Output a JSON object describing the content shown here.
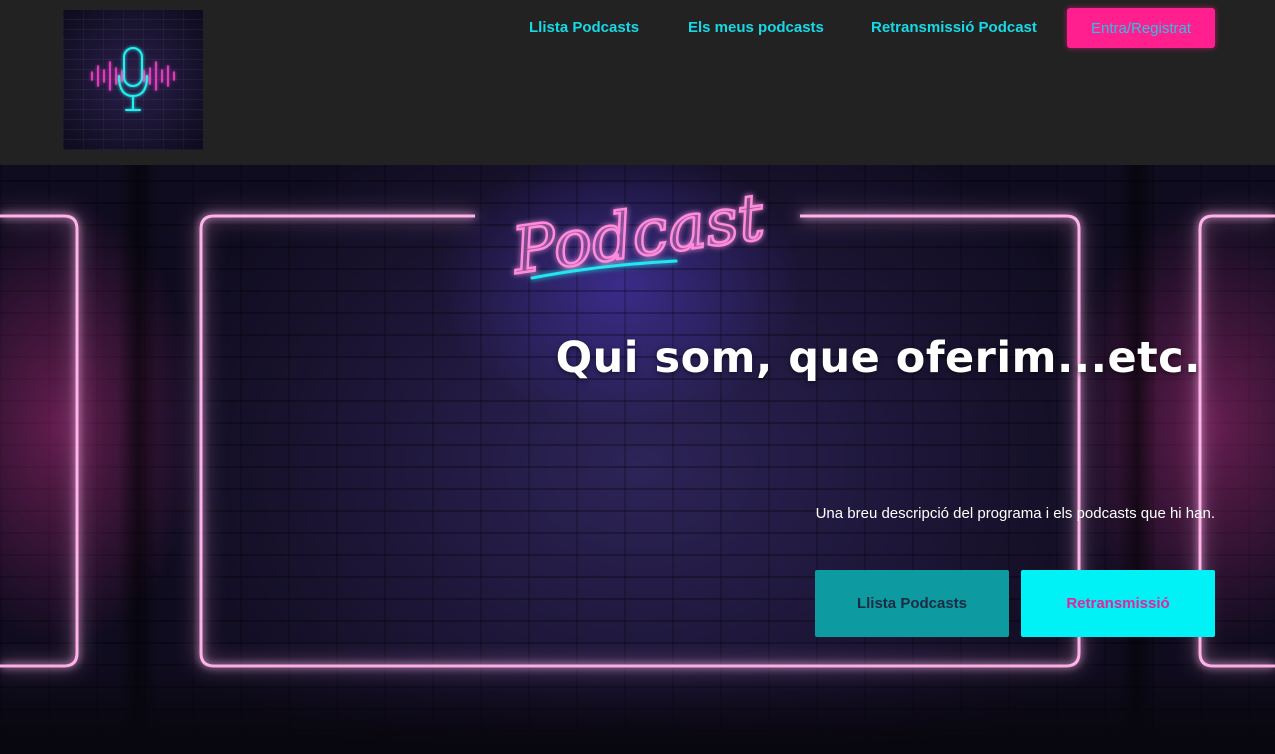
{
  "header": {
    "logo": {
      "icon": "microphone-soundwave-icon",
      "alt": ""
    },
    "nav": [
      {
        "label": "Llista Podcasts"
      },
      {
        "label": "Els meus podcasts"
      },
      {
        "label": "Retransmissió Podcast"
      }
    ],
    "login_label": "Entra/Registrat"
  },
  "hero": {
    "neon_sign": "Podcast",
    "title": "Qui som, que oferim...etc.",
    "description": "Una breu descripció del programa i els podcasts que hi han.",
    "buttons": [
      {
        "label": "Llista Podcasts"
      },
      {
        "label": "Retransmissió"
      }
    ]
  },
  "colors": {
    "header_bg": "#222222",
    "nav_link": "#17d9e6",
    "login_bg": "#ff1f8e",
    "login_text": "#29c2e6",
    "neon_pink": "#ff5cc8",
    "btn_list_bg": "#0d9aa0",
    "btn_list_text": "#1b2b43",
    "btn_live_bg": "#00f2f7",
    "btn_live_text": "#e4249a"
  }
}
